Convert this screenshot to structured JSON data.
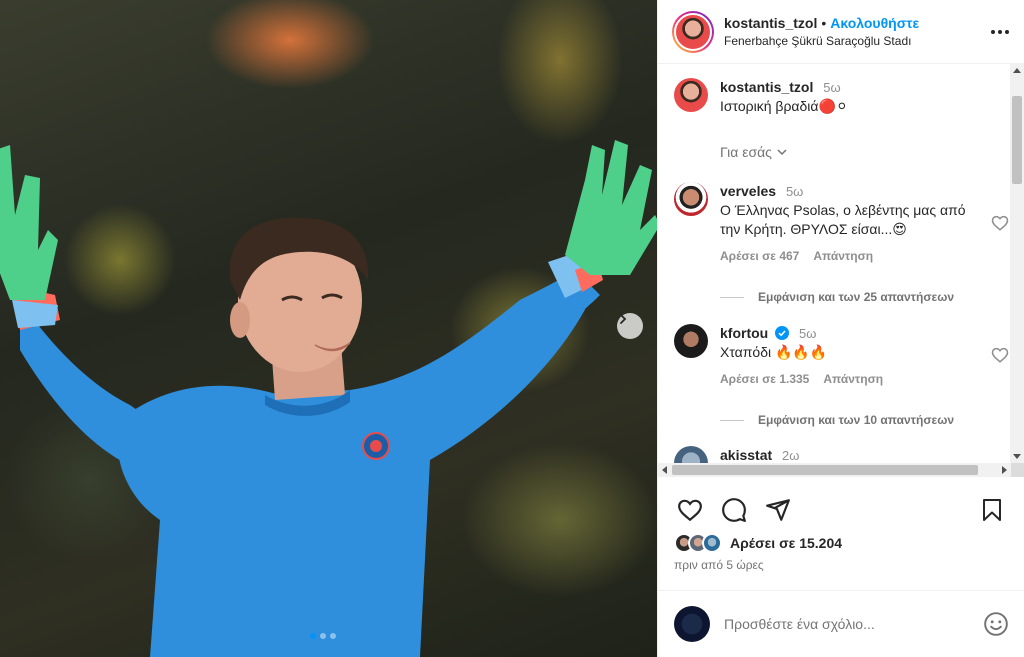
{
  "post": {
    "author": "kostantis_tzol",
    "dot": "•",
    "follow_label": "Ακολουθήστε",
    "location": "Fenerbahçe Şükrü Saraçoğlu Stadı",
    "caption_time": "5ω",
    "caption": "Ιστορική βραδιά🔴⚪",
    "for_you_label": "Για εσάς",
    "likes_label": "Αρέσει σε 15.204",
    "posted_ago": "πριν από 5 ώρες",
    "add_comment_placeholder": "Προσθέστε ένα σχόλιο..."
  },
  "comments": [
    {
      "user": "verveles",
      "time": "5ω",
      "text": "Ο Έλληνας Psolas, ο λεβέντης μας από την Κρήτη. ΘΡΥΛΟΣ είσαι...😍",
      "likes": "Αρέσει σε 467",
      "reply_label": "Απάντηση",
      "view_replies": "Εμφάνιση και των 25 απαντήσεων"
    },
    {
      "user": "kfortou",
      "time": "5ω",
      "text": "Χταπόδι 🔥🔥🔥",
      "likes": "Αρέσει σε 1.335",
      "reply_label": "Απάντηση",
      "view_replies": "Εμφάνιση και των 10 απαντήσεων"
    },
    {
      "user": "akisstat",
      "time": "2ω"
    }
  ],
  "carousel": {
    "count": 3,
    "active_index": 0
  },
  "colors": {
    "accent": "#0095f6",
    "kit_blue": "#2f8fdc",
    "glove_green": "#4fd08a"
  },
  "icons": [
    "heart-icon",
    "comment-icon",
    "share-icon",
    "bookmark-icon",
    "more-icon",
    "chevron-right-icon",
    "chevron-down-icon",
    "verified-icon",
    "emoji-icon"
  ]
}
